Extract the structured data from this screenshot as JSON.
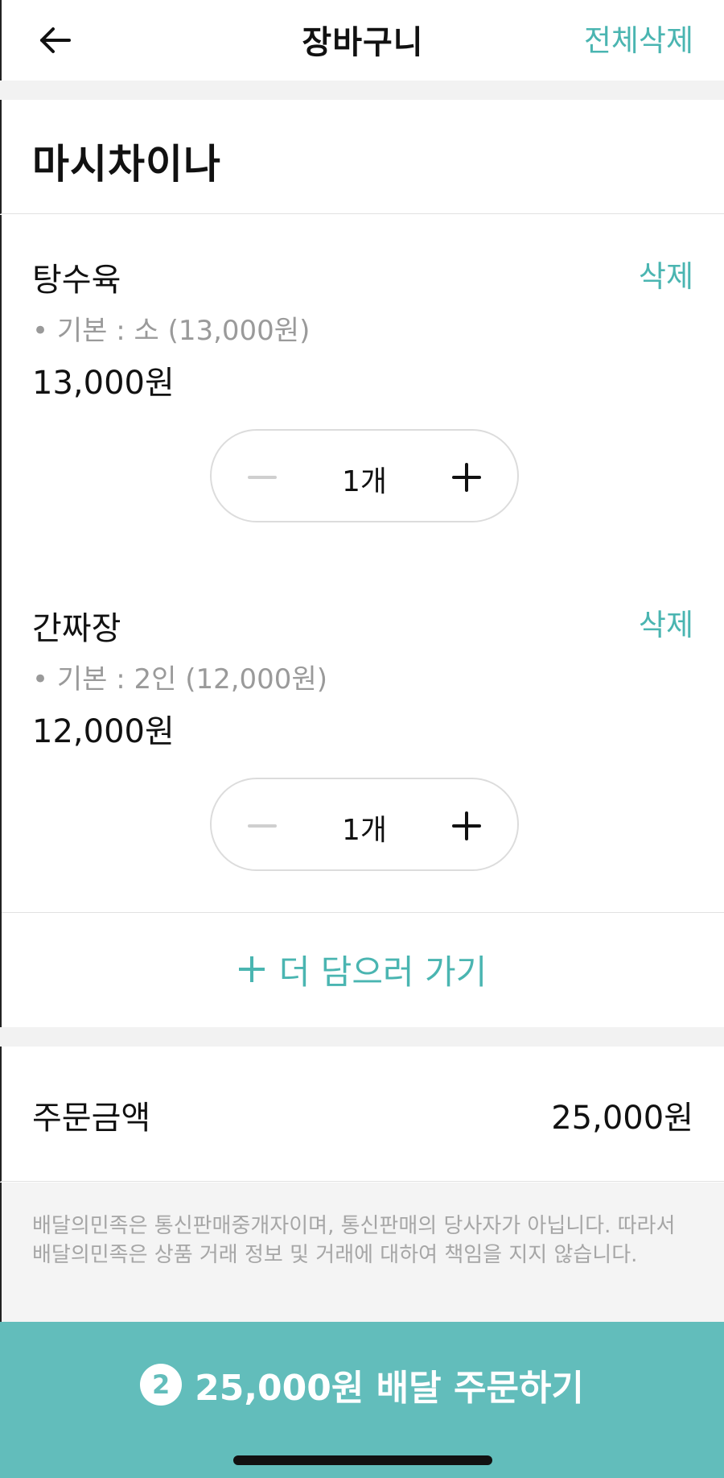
{
  "header": {
    "title": "장바구니",
    "clear_all_label": "전체삭제",
    "back_icon": "arrow-left-icon"
  },
  "store": {
    "name": "마시차이나"
  },
  "items": [
    {
      "name": "탕수육",
      "option": "• 기본 : 소 (13,000원)",
      "price": "13,000원",
      "delete_label": "삭제",
      "quantity": "1개"
    },
    {
      "name": "간짜장",
      "option": "• 기본 : 2인 (12,000원)",
      "price": "12,000원",
      "delete_label": "삭제",
      "quantity": "1개"
    }
  ],
  "add_more": {
    "label": "더 담으러 가기"
  },
  "summary": {
    "label": "주문금액",
    "value": "25,000원"
  },
  "notice": {
    "line1": "배달의민족은 통신판매중개자이며, 통신판매의 당사자가 아닙니다. 따라서",
    "line2": "배달의민족은 상품 거래 정보 및 거래에 대하여 책임을 지지 않습니다."
  },
  "order_button": {
    "count": "2",
    "label": "25,000원 배달 주문하기"
  },
  "colors": {
    "accent": "#4ab5b1",
    "button_bg": "#62bdbb"
  }
}
